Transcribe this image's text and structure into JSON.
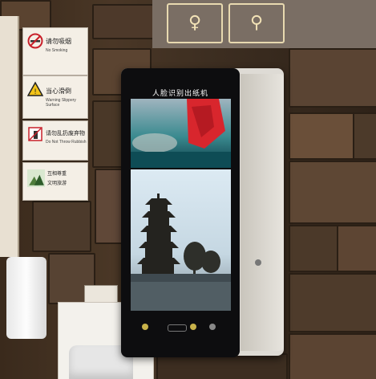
{
  "scene": {
    "description": "",
    "signs": [
      {
        "title": "请勿吸烟",
        "subtitle": "No Smoking",
        "icon": "no-smoking-icon"
      },
      {
        "title": "当心滑倒",
        "subtitle": "Warning Slippery Surface",
        "icon": "warning-slippery-icon"
      },
      {
        "title": "请勿乱扔废弃物",
        "subtitle": "Do Not Throw Rubbish",
        "icon": "no-littering-icon"
      },
      {
        "title": "互相尊重",
        "subtitle": "文明旅游",
        "icon": "nature-illustration-icon"
      }
    ],
    "banner_icons": [
      "restroom-person-icon",
      "restroom-person-icon"
    ],
    "kiosk": {
      "screen_title": "人脸识别出纸机",
      "top_image": "red-object-photo",
      "bottom_image": "pagoda-photo"
    }
  }
}
